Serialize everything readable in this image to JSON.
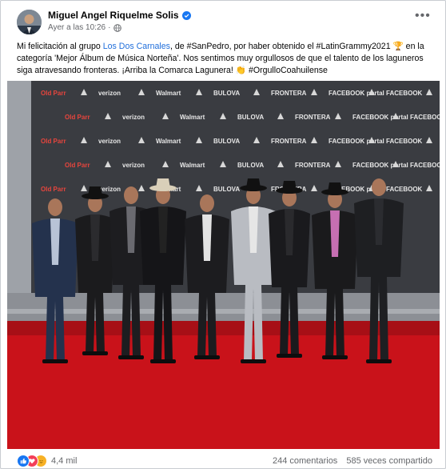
{
  "post": {
    "author": "Miguel Angel Riquelme Solis",
    "timestamp": "Ayer a las 10:26",
    "separator": "·",
    "text_parts": [
      {
        "text": "Mi felicitación al grupo ",
        "link": false
      },
      {
        "text": "Los Dos Carnales",
        "link": true
      },
      {
        "text": ", de #SanPedro, por haber obtenido el #LatinGrammy2021 ",
        "link": false
      },
      {
        "text": "🏆",
        "link": false
      },
      {
        "text": " en la categoría 'Mejor Álbum de Música Norteña'. Nos sentimos muy orgullosos de que el talento de los laguneros siga atravesando fronteras. ¡Arriba la Comarca Lagunera! ",
        "link": false
      },
      {
        "text": "👏",
        "link": false
      },
      {
        "text": " #OrgulloCoahuilense",
        "link": false
      }
    ]
  },
  "backdrop_logos": [
    "Old Parr",
    "verizon",
    "Walmart",
    "BULOVA",
    "FRONTERA",
    "FACEBOOK portal",
    "FACEBOOK"
  ],
  "footer": {
    "reactions": [
      "like",
      "love",
      "care"
    ],
    "reaction_count": "4,4 mil",
    "comments": "244 comentarios",
    "shares": "585 veces compartido"
  },
  "colors": {
    "link": "#216fdb",
    "carpet": "#c9121a",
    "backdrop": "#3d3f44",
    "like": "#1877f2"
  }
}
